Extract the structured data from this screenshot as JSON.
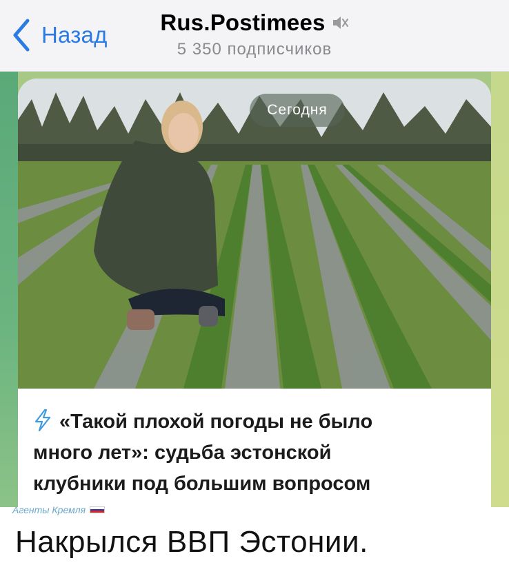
{
  "header": {
    "back_label": "Назад",
    "channel_title": "Rus.Postimees",
    "subscribers": "5 350 подписчиков",
    "mute_icon": "mute-speaker-icon",
    "back_icon": "chevron-left-icon",
    "accent_color": "#2b7be4"
  },
  "message": {
    "date_badge": "Сегодня",
    "headline_lines": [
      "«Такой плохой погоды не было",
      "много лет»: судьба эстонской",
      "клубники под большим вопросом"
    ],
    "headline_icon": "lightning-bolt-icon",
    "photo_description_icon": "photo"
  },
  "watermark": {
    "text": "Агенты Кремля",
    "icon": "russian-flag-icon"
  },
  "caption": "Накрылся ВВП Эстонии."
}
